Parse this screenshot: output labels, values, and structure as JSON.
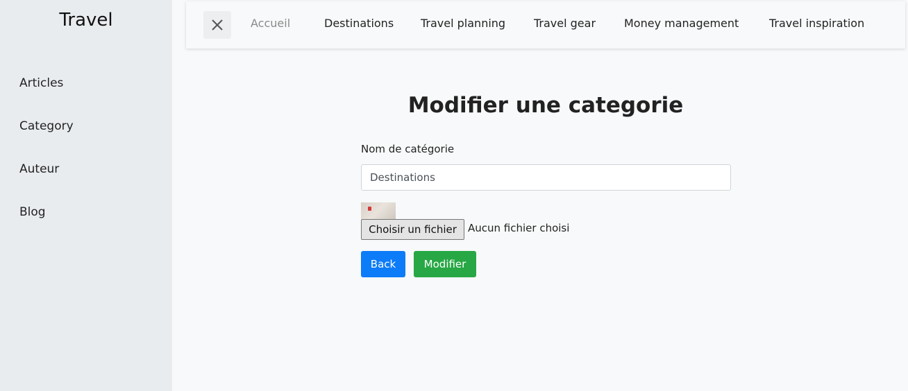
{
  "sidebar": {
    "brand": "Travel",
    "items": [
      {
        "label": "Articles"
      },
      {
        "label": "Category"
      },
      {
        "label": "Auteur"
      },
      {
        "label": "Blog"
      }
    ]
  },
  "topbar": {
    "close_icon": "close-icon",
    "links": [
      {
        "label": "Accueil"
      },
      {
        "label": "Destinations"
      },
      {
        "label": "Travel planning"
      },
      {
        "label": "Travel gear"
      },
      {
        "label": "Money management"
      },
      {
        "label": "Travel inspiration"
      }
    ]
  },
  "form": {
    "title": "Modifier une categorie",
    "name_label": "Nom de catégorie",
    "name_value": "Destinations",
    "file_button": "Choisir un fichier",
    "file_status": "Aucun fichier choisi",
    "back_label": "Back",
    "submit_label": "Modifier"
  },
  "colors": {
    "back_button": "#0d7cf8",
    "submit_button": "#28a745",
    "sidebar_bg": "#e9ecef"
  }
}
